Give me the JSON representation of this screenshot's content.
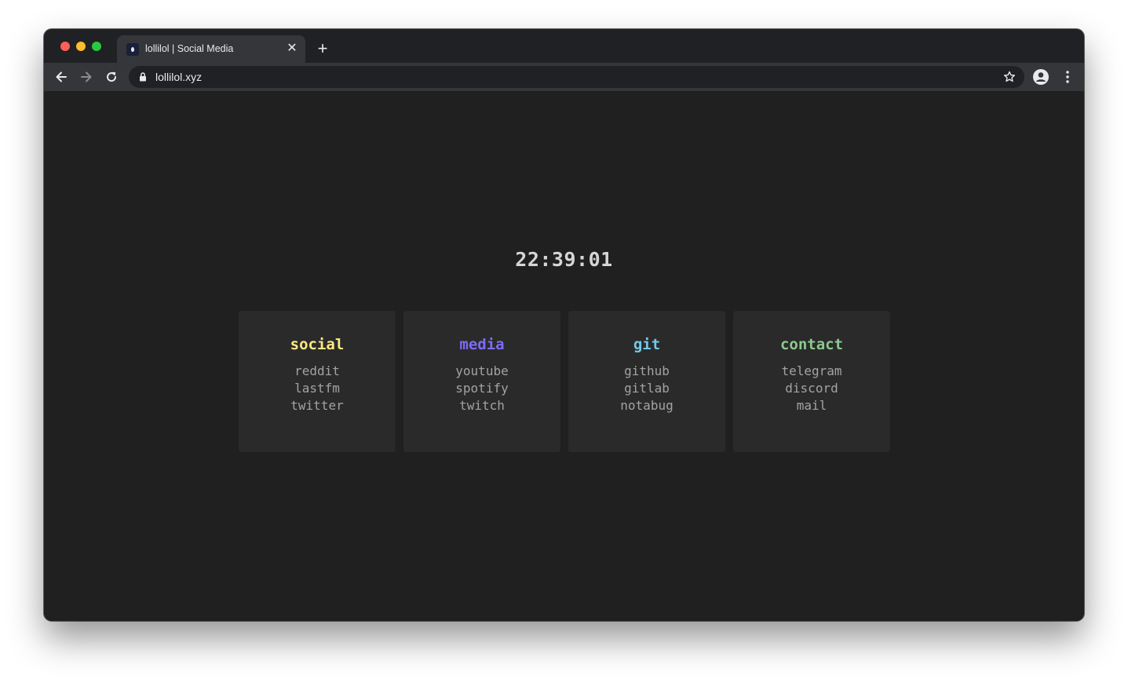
{
  "browser": {
    "tab_title": "lollilol | Social Media",
    "tab_close": "✕",
    "new_tab": "+",
    "url": "lollilol.xyz"
  },
  "page": {
    "clock": "22:39:01",
    "cards": [
      {
        "title": "social",
        "color": "#fce883",
        "links": [
          "reddit",
          "lastfm",
          "twitter"
        ]
      },
      {
        "title": "media",
        "color": "#7b6cf6",
        "links": [
          "youtube",
          "spotify",
          "twitch"
        ]
      },
      {
        "title": "git",
        "color": "#72c9e6",
        "links": [
          "github",
          "gitlab",
          "notabug"
        ]
      },
      {
        "title": "contact",
        "color": "#8cc98f",
        "links": [
          "telegram",
          "discord",
          "mail"
        ]
      }
    ]
  }
}
